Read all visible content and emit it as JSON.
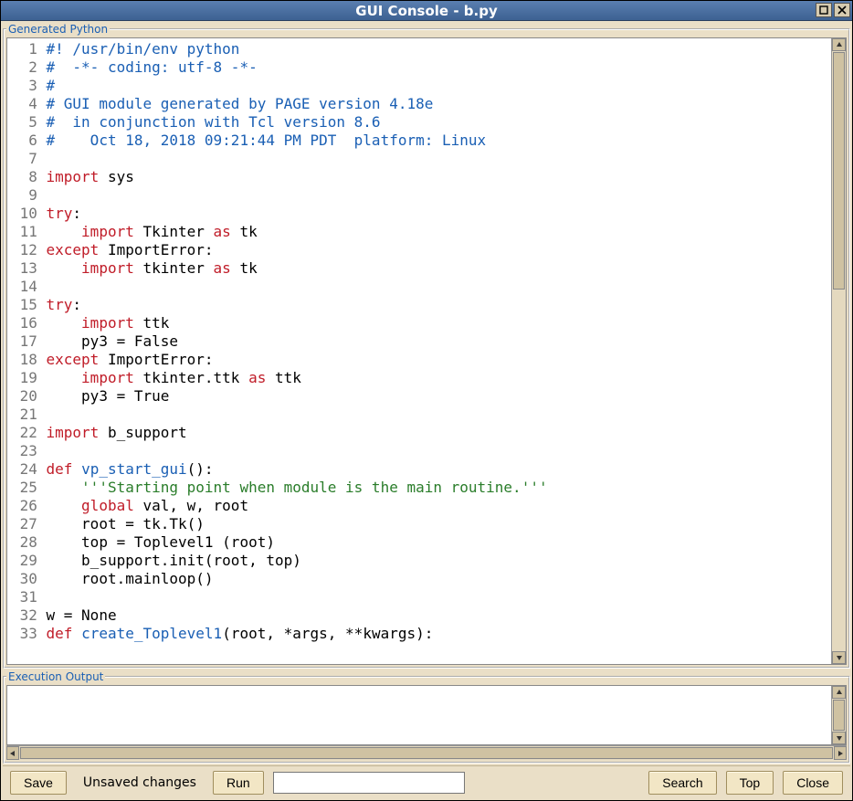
{
  "window": {
    "title": "GUI Console - b.py"
  },
  "panels": {
    "generated": "Generated Python",
    "execution": "Execution Output"
  },
  "code": {
    "lines": [
      {
        "n": 1,
        "tokens": [
          [
            "com",
            "#! /usr/bin/env python"
          ]
        ]
      },
      {
        "n": 2,
        "tokens": [
          [
            "com",
            "#  -*- coding: utf-8 -*-"
          ]
        ]
      },
      {
        "n": 3,
        "tokens": [
          [
            "com",
            "#"
          ]
        ]
      },
      {
        "n": 4,
        "tokens": [
          [
            "com",
            "# GUI module generated by PAGE version 4.18e"
          ]
        ]
      },
      {
        "n": 5,
        "tokens": [
          [
            "com",
            "#  in conjunction with Tcl version 8.6"
          ]
        ]
      },
      {
        "n": 6,
        "tokens": [
          [
            "com",
            "#    Oct 18, 2018 09:21:44 PM PDT  platform: Linux"
          ]
        ]
      },
      {
        "n": 7,
        "tokens": []
      },
      {
        "n": 8,
        "tokens": [
          [
            "key",
            "import"
          ],
          [
            "txt",
            " sys"
          ]
        ]
      },
      {
        "n": 9,
        "tokens": []
      },
      {
        "n": 10,
        "tokens": [
          [
            "key",
            "try"
          ],
          [
            "txt",
            ":"
          ]
        ]
      },
      {
        "n": 11,
        "tokens": [
          [
            "txt",
            "    "
          ],
          [
            "key",
            "import"
          ],
          [
            "txt",
            " Tkinter "
          ],
          [
            "key",
            "as"
          ],
          [
            "txt",
            " tk"
          ]
        ]
      },
      {
        "n": 12,
        "tokens": [
          [
            "key",
            "except"
          ],
          [
            "txt",
            " ImportError:"
          ]
        ]
      },
      {
        "n": 13,
        "tokens": [
          [
            "txt",
            "    "
          ],
          [
            "key",
            "import"
          ],
          [
            "txt",
            " tkinter "
          ],
          [
            "key",
            "as"
          ],
          [
            "txt",
            " tk"
          ]
        ]
      },
      {
        "n": 14,
        "tokens": []
      },
      {
        "n": 15,
        "tokens": [
          [
            "key",
            "try"
          ],
          [
            "txt",
            ":"
          ]
        ]
      },
      {
        "n": 16,
        "tokens": [
          [
            "txt",
            "    "
          ],
          [
            "key",
            "import"
          ],
          [
            "txt",
            " ttk"
          ]
        ]
      },
      {
        "n": 17,
        "tokens": [
          [
            "txt",
            "    py3 = False"
          ]
        ]
      },
      {
        "n": 18,
        "tokens": [
          [
            "key",
            "except"
          ],
          [
            "txt",
            " ImportError:"
          ]
        ]
      },
      {
        "n": 19,
        "tokens": [
          [
            "txt",
            "    "
          ],
          [
            "key",
            "import"
          ],
          [
            "txt",
            " tkinter.ttk "
          ],
          [
            "key",
            "as"
          ],
          [
            "txt",
            " ttk"
          ]
        ]
      },
      {
        "n": 20,
        "tokens": [
          [
            "txt",
            "    py3 = True"
          ]
        ]
      },
      {
        "n": 21,
        "tokens": []
      },
      {
        "n": 22,
        "tokens": [
          [
            "key",
            "import"
          ],
          [
            "txt",
            " b_support"
          ]
        ]
      },
      {
        "n": 23,
        "tokens": []
      },
      {
        "n": 24,
        "tokens": [
          [
            "key",
            "def"
          ],
          [
            "txt",
            " "
          ],
          [
            "def",
            "vp_start_gui"
          ],
          [
            "txt",
            "():"
          ]
        ]
      },
      {
        "n": 25,
        "tokens": [
          [
            "txt",
            "    "
          ],
          [
            "str",
            "'''Starting point when module is the main routine.'''"
          ]
        ]
      },
      {
        "n": 26,
        "tokens": [
          [
            "txt",
            "    "
          ],
          [
            "key",
            "global"
          ],
          [
            "txt",
            " val, w, root"
          ]
        ]
      },
      {
        "n": 27,
        "tokens": [
          [
            "txt",
            "    root = tk.Tk()"
          ]
        ]
      },
      {
        "n": 28,
        "tokens": [
          [
            "txt",
            "    top = Toplevel1 (root)"
          ]
        ]
      },
      {
        "n": 29,
        "tokens": [
          [
            "txt",
            "    b_support.init(root, top)"
          ]
        ]
      },
      {
        "n": 30,
        "tokens": [
          [
            "txt",
            "    root.mainloop()"
          ]
        ]
      },
      {
        "n": 31,
        "tokens": []
      },
      {
        "n": 32,
        "tokens": [
          [
            "txt",
            "w = None"
          ]
        ]
      },
      {
        "n": 33,
        "tokens": [
          [
            "key",
            "def"
          ],
          [
            "txt",
            " "
          ],
          [
            "def",
            "create_Toplevel1"
          ],
          [
            "txt",
            "(root, *args, **kwargs):"
          ]
        ]
      }
    ]
  },
  "execution_output": "",
  "toolbar": {
    "save": "Save",
    "status": "Unsaved changes",
    "run": "Run",
    "search_value": "",
    "search_placeholder": "",
    "search": "Search",
    "top": "Top",
    "close": "Close"
  },
  "colors": {
    "bg": "#eadfc7",
    "titlebar": "#3d6192",
    "legend": "#1a5fb4",
    "keyword": "#c01c28",
    "comment": "#1a5fb4",
    "string": "#2a7d2a"
  }
}
